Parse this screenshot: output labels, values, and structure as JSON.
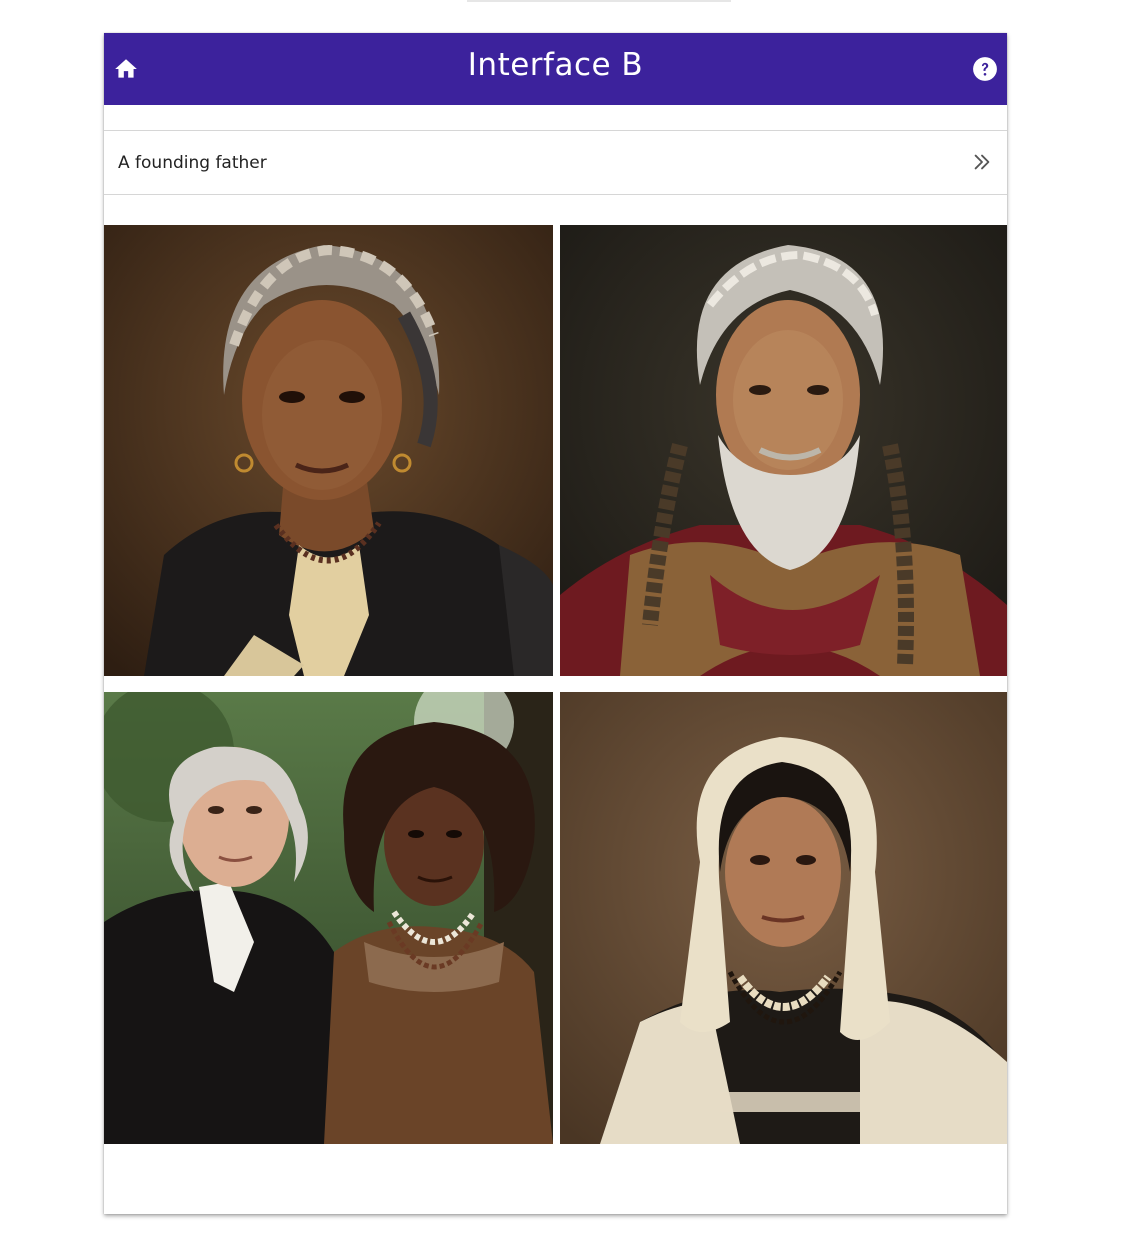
{
  "app_bar": {
    "title": "Interface B",
    "color": "#3c229c",
    "home_icon": "home-icon",
    "help_icon": "help-icon"
  },
  "prompt": {
    "text": "A founding father",
    "action_icon": "double-chevron-right-icon"
  },
  "images": [
    {
      "slot": "top-left",
      "depicts": "portrait"
    },
    {
      "slot": "top-right",
      "depicts": "portrait"
    },
    {
      "slot": "bottom-left",
      "depicts": "portrait"
    },
    {
      "slot": "bottom-right",
      "depicts": "portrait"
    }
  ]
}
